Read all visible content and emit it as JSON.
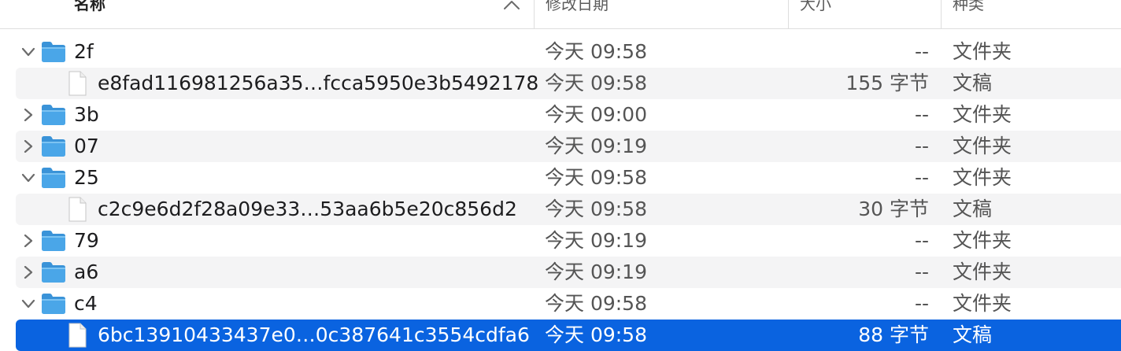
{
  "header": {
    "name_label": "名称",
    "date_label": "修改日期",
    "size_label": "大小",
    "kind_label": "种类",
    "sort_icon": "chevron-up-icon"
  },
  "colors": {
    "selection": "#0a63e0",
    "folder": "#4aa6e8",
    "alt_row": "#f4f4f5"
  },
  "rows": [
    {
      "type": "folder",
      "expanded": true,
      "name": "2f",
      "date": "今天 09:58",
      "size": "--",
      "kind": "文件夹"
    },
    {
      "type": "file",
      "name": "e8fad116981256a35…fcca5950e3b5492178",
      "date": "今天 09:58",
      "size": "155 字节",
      "kind": "文稿"
    },
    {
      "type": "folder",
      "expanded": false,
      "name": "3b",
      "date": "今天 09:00",
      "size": "--",
      "kind": "文件夹"
    },
    {
      "type": "folder",
      "expanded": false,
      "name": "07",
      "date": "今天 09:19",
      "size": "--",
      "kind": "文件夹"
    },
    {
      "type": "folder",
      "expanded": true,
      "name": "25",
      "date": "今天 09:58",
      "size": "--",
      "kind": "文件夹"
    },
    {
      "type": "file",
      "name": "c2c9e6d2f28a09e33…53aa6b5e20c856d2",
      "date": "今天 09:58",
      "size": "30 字节",
      "kind": "文稿"
    },
    {
      "type": "folder",
      "expanded": false,
      "name": "79",
      "date": "今天 09:19",
      "size": "--",
      "kind": "文件夹"
    },
    {
      "type": "folder",
      "expanded": false,
      "name": "a6",
      "date": "今天 09:19",
      "size": "--",
      "kind": "文件夹"
    },
    {
      "type": "folder",
      "expanded": true,
      "name": "c4",
      "date": "今天 09:58",
      "size": "--",
      "kind": "文件夹"
    },
    {
      "type": "file",
      "name": "6bc13910433437e0…0c387641c3554cdfa6",
      "date": "今天 09:58",
      "size": "88 字节",
      "kind": "文稿",
      "selected": true
    }
  ]
}
